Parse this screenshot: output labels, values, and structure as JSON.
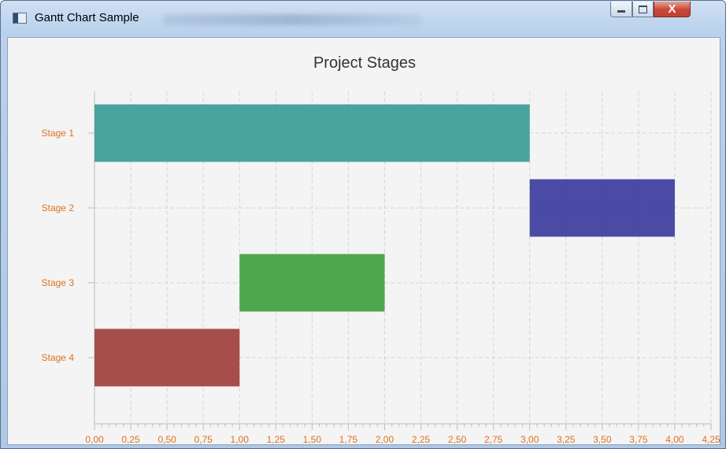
{
  "window": {
    "title": "Gantt Chart Sample",
    "icon": "app-window-icon",
    "controls": {
      "minimize_icon": "minimize-icon",
      "maximize_icon": "maximize-icon",
      "close_label": "X"
    }
  },
  "chart_data": {
    "type": "bar",
    "orientation": "horizontal-gantt",
    "title": "Project Stages",
    "xlabel": "",
    "ylabel": "",
    "xlim": [
      0,
      4.25
    ],
    "x_ticks": [
      "0,00",
      "0,25",
      "0,50",
      "0,75",
      "1,00",
      "1,25",
      "1,50",
      "1,75",
      "2,00",
      "2,25",
      "2,50",
      "2,75",
      "3,00",
      "3,25",
      "3,50",
      "3,75",
      "4,00",
      "4,25"
    ],
    "grid": true,
    "categories": [
      "Stage 1",
      "Stage 2",
      "Stage 3",
      "Stage 4"
    ],
    "tasks": [
      {
        "category": "Stage 1",
        "start": 0.0,
        "end": 3.0,
        "color": "#3a9b96"
      },
      {
        "category": "Stage 2",
        "start": 3.0,
        "end": 4.0,
        "color": "#3c3c9e"
      },
      {
        "category": "Stage 3",
        "start": 1.0,
        "end": 2.0,
        "color": "#3f9f3f"
      },
      {
        "category": "Stage 4",
        "start": 0.0,
        "end": 1.0,
        "color": "#9e3f3a"
      }
    ],
    "label_color": "#e07020"
  }
}
